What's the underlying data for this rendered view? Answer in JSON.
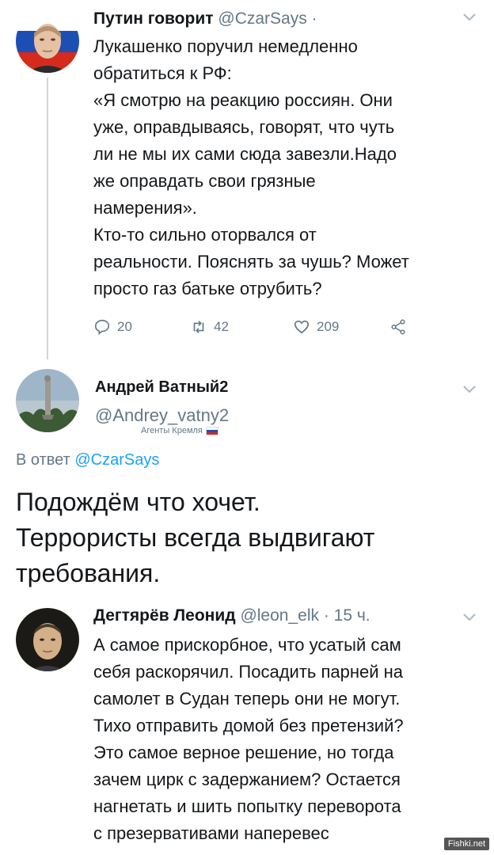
{
  "tweet1": {
    "name": "Путин говорит",
    "handle": "@CzarSays ·",
    "lines": [
      "Лукашенко поручил немедленно",
      "обратиться к РФ:",
      "«Я смотрю на реакцию россиян. Они",
      "уже, оправдываясь, говорят, что чуть",
      "ли не мы их сами сюда завезли.Надо",
      "же оправдать свои грязные",
      "намерения».",
      "Кто-то сильно оторвался от",
      "реальности. Пояснять за чушь? Может",
      "просто газ батьке отрубить?"
    ],
    "replies": "20",
    "retweets": "42",
    "likes": "209"
  },
  "tweet2": {
    "name": "Андрей Ватный2",
    "handle": "@Andrey_vatny2",
    "badge": "Агенты Кремля",
    "reply_prefix": "В ответ",
    "reply_to": "@CzarSays",
    "lines": [
      "Подождём что хочет.",
      "Террористы всегда выдвигают",
      "требования."
    ]
  },
  "tweet3": {
    "name": "Дегтярёв Леонид",
    "handle": "@leon_elk · 15 ч.",
    "lines": [
      "А самое прискорбное, что усатый сам",
      "себя раскорячил. Посадить парней на",
      "самолет в Судан теперь они не могут.",
      "Тихо отправить домой без претензий?",
      "Это самое верное решение, но тогда",
      "зачем цирк с задержанием? Остается",
      "нагнетать и шить попытку переворота",
      "с презервативами наперевес"
    ]
  },
  "watermark": "Fishki.net",
  "colors": {
    "accent": "#1da1f2",
    "muted": "#657786",
    "thread": "#ccd6dd"
  }
}
